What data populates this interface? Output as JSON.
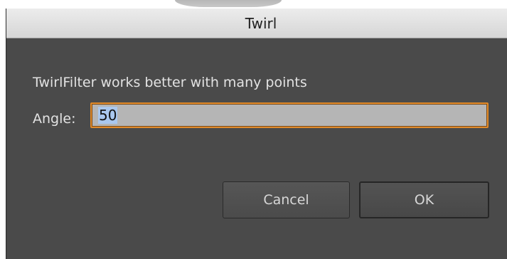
{
  "dialog": {
    "title": "Twirl",
    "message": "TwirlFilter works better with many points",
    "angle": {
      "label": "Angle:",
      "value": "50"
    },
    "buttons": {
      "cancel_label": "Cancel",
      "ok_label": "OK"
    }
  },
  "colors": {
    "dialog_background": "#4a4a4a",
    "focus_ring": "#e08a2a",
    "selection_highlight": "#a9c7ee"
  }
}
